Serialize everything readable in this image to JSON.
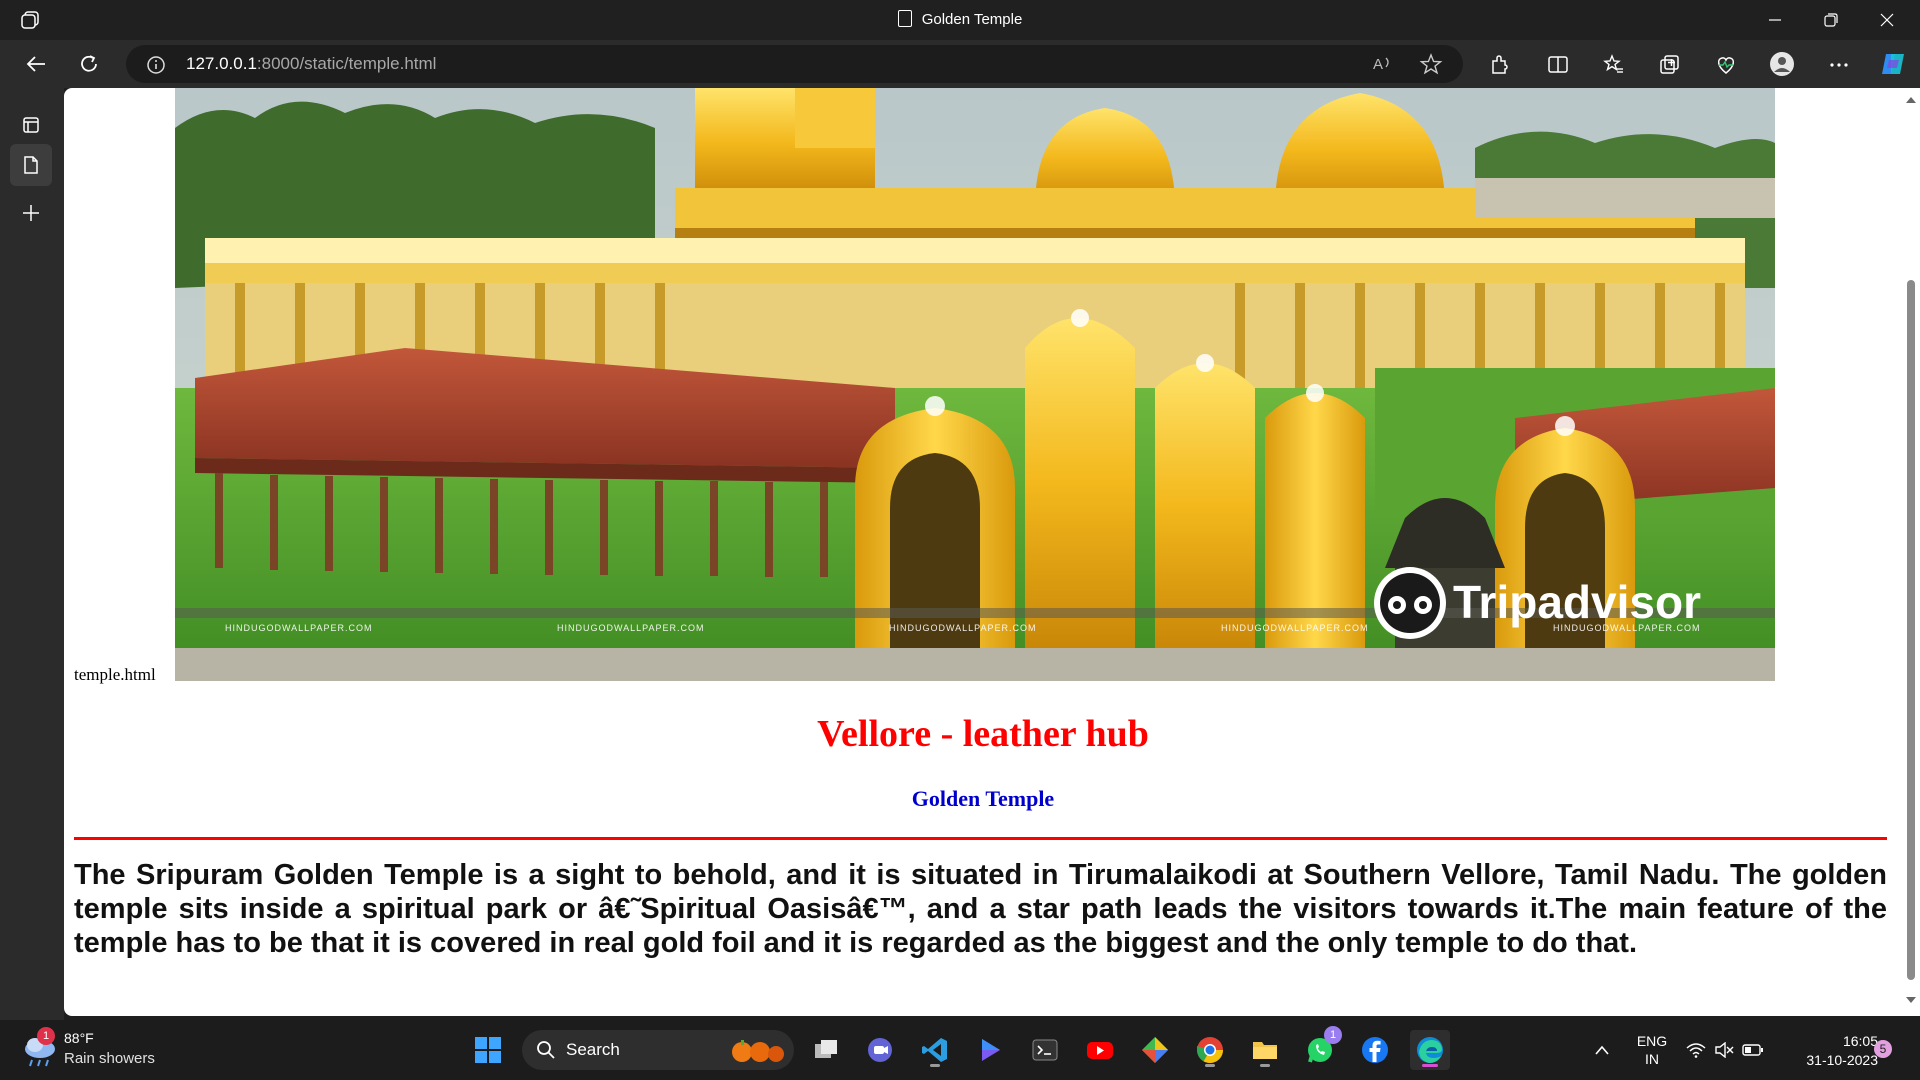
{
  "window": {
    "title": "Golden Temple"
  },
  "address_bar": {
    "url_host": "127.0.0.1",
    "url_rest": ":8000/static/temple.html"
  },
  "page": {
    "image_alt_text": "temple.html",
    "image_caption_watermarks": [
      "HINDUGODWALLPAPER.COM",
      "HINDUGODWALLPAPER.COM",
      "HINDUGODWALLPAPER.COM",
      "HINDUGODWALLPAPER.COM",
      "HINDUGODWALLPAPER.COM"
    ],
    "image_logo_text": "Tripadvisor",
    "heading": "Vellore - leather hub",
    "subheading": "Golden Temple",
    "paragraph": "The Sripuram Golden Temple is a sight to behold, and it is situated in Tirumalaikodi at Southern Vellore, Tamil Nadu. The golden temple sits inside a spiritual park or â€˜Spiritual Oasisâ€™, and a star path leads the visitors towards it.The main feature of the temple has to be that it is covered in real gold foil and it is regarded as the biggest and the only temple to do that.",
    "colors": {
      "heading": "#ff0000",
      "subheading": "#0000cc",
      "rule": "#ff0000"
    }
  },
  "taskbar": {
    "weather_temp": "88°F",
    "weather_condition": "Rain showers",
    "weather_badge": "1",
    "search_label": "Search",
    "whatsapp_badge": "1",
    "language_top": "ENG",
    "language_bottom": "IN",
    "time": "16:05",
    "date": "31-10-2023",
    "notification_count": "5"
  }
}
